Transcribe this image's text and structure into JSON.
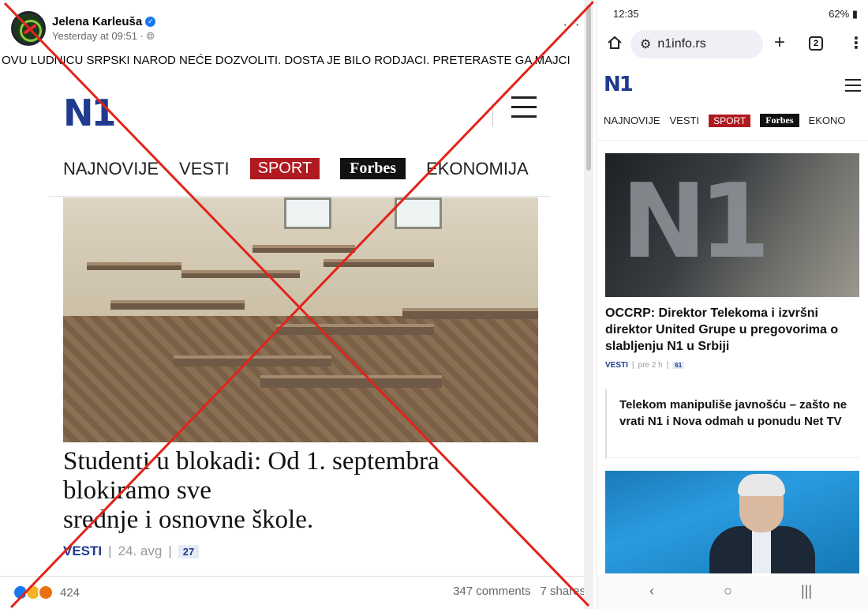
{
  "facebook": {
    "author": "Jelena Karleuša",
    "time": "Yesterday at 09:51 · ",
    "more": "···",
    "post_text": "OVU LUDNICU SRPSKI NAROD NEĆE DOZVOLITI. DOSTA JE BILO RODJACI. PRETERASTE GA MAJCI",
    "shared": {
      "logo": "N1",
      "nav": [
        "NAJNOVIJE",
        "VESTI",
        "SPORT",
        "Forbes",
        "EKONOMIJA"
      ],
      "title_lines": [
        "Studenti u blokadi: Od 1. septembra",
        "blokiramo sve",
        "srednje i osnovne škole."
      ],
      "category": "VESTI",
      "date": "24. avg",
      "comment_count": "27"
    },
    "reactions_count": "424",
    "comments": "347 comments",
    "shares": "7 shares"
  },
  "phone": {
    "status_time": "12:35",
    "status_right": "62%",
    "url": "n1info.rs",
    "tab_count": "2",
    "site_logo": "N1",
    "site_nav": [
      "NAJNOVIJE",
      "VESTI",
      "SPORT",
      "Forbes",
      "EKONO"
    ],
    "article1": {
      "title": "OCCRP: Direktor Telekoma i izvršni direktor United Grupe u pregovorima o slabljenju N1 u Srbiji",
      "category": "VESTI",
      "time": "pre 2 h",
      "count": "61"
    },
    "article2": {
      "title": "Telekom manipuliše javnošću – zašto ne vrati N1 i Nova odmah u ponudu Net TV"
    },
    "article1_image_text": "N1"
  },
  "colors": {
    "cross": "#e2231a",
    "n1_blue": "#1f3a8f",
    "sport_red": "#b0191f",
    "fb_blue": "#1877f2"
  }
}
